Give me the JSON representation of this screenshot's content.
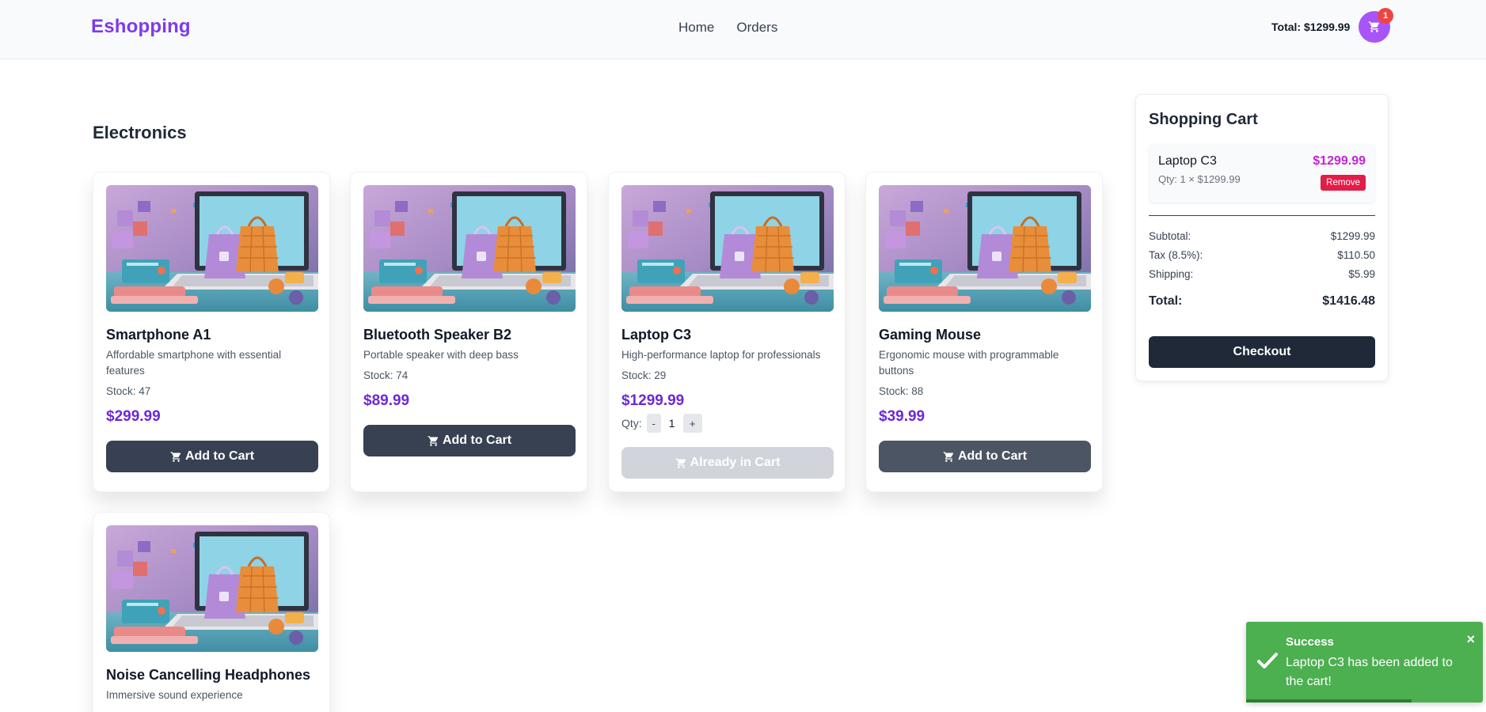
{
  "header": {
    "brand": "Eshopping",
    "nav": [
      "Home",
      "Orders"
    ],
    "total_label": "Total: $1299.99",
    "cart_count": "1"
  },
  "section": {
    "title": "Electronics"
  },
  "products": [
    {
      "name": "Smartphone A1",
      "description": "Affordable smartphone with essential features",
      "stock": "Stock: 47",
      "price": "$299.99",
      "button": "Add to Cart"
    },
    {
      "name": "Bluetooth Speaker B2",
      "description": "Portable speaker with deep bass",
      "stock": "Stock: 74",
      "price": "$89.99",
      "button": "Add to Cart"
    },
    {
      "name": "Laptop C3",
      "description": "High-performance laptop for professionals",
      "stock": "Stock: 29",
      "price": "$1299.99",
      "qty_label": "Qty:",
      "qty_minus": "-",
      "qty_value": "1",
      "qty_plus": "+",
      "button": "Already in Cart"
    },
    {
      "name": "Gaming Mouse",
      "description": "Ergonomic mouse with programmable buttons",
      "stock": "Stock: 88",
      "price": "$39.99",
      "button": "Add to Cart"
    },
    {
      "name": "Noise Cancelling Headphones",
      "description": "Immersive sound experience"
    }
  ],
  "cart": {
    "title": "Shopping Cart",
    "item": {
      "name": "Laptop C3",
      "qty_line": "Qty: 1 × $1299.99",
      "price": "$1299.99",
      "remove": "Remove"
    },
    "subtotal_label": "Subtotal:",
    "subtotal": "$1299.99",
    "tax_label": "Tax (8.5%):",
    "tax": "$110.50",
    "shipping_label": "Shipping:",
    "shipping": "$5.99",
    "total_label": "Total:",
    "total": "$1416.48",
    "checkout": "Checkout"
  },
  "toast": {
    "title": "Success",
    "message": "Laptop C3 has been added to the cart!",
    "close": "×",
    "progress": 0.7
  },
  "colors": {
    "brand": "#7c3aed",
    "accent": "#a855f7",
    "price": "#6d28d9",
    "button": "#374151",
    "remove": "#e11d48",
    "success": "#4caf50"
  }
}
